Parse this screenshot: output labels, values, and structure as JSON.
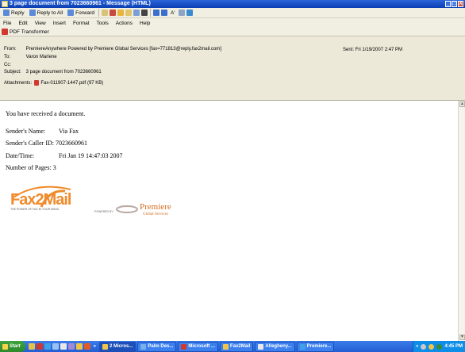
{
  "window": {
    "title": "3 page document from 7023660961 - Message (HTML)",
    "btn_minimize": "_",
    "btn_maximize": "□",
    "btn_close": "X"
  },
  "toolbar": {
    "reply": "Reply",
    "reply_all": "Reply to All",
    "forward": "Forward",
    "font": "A'"
  },
  "menu": [
    "File",
    "Edit",
    "View",
    "Insert",
    "Format",
    "Tools",
    "Actions",
    "Help"
  ],
  "toolbar2": {
    "pdf_transformer": "PDF Transformer"
  },
  "header": {
    "from_label": "From:",
    "from_value": "PremiereAnywhere Powered by Premiere Global Services [fax=771813@reply.fax2mail.com]",
    "to_label": "To:",
    "to_value": "Varon Marlene",
    "cc_label": "Cc:",
    "cc_value": "",
    "subject_label": "Subject:",
    "subject_value": "3 page document from 7023660961",
    "attachments_label": "Attachments:",
    "attachment": "Fax-011907-1447.pdf (97 KB)",
    "sent_label": "Sent:",
    "sent_value": "Fri 1/19/2007 2:47 PM"
  },
  "message": {
    "intro": "You have received a document.",
    "sender_name_label": "Sender's Name:",
    "sender_name": "Via Fax",
    "caller_id_label": "Sender's Caller ID:",
    "caller_id": "7023660961",
    "datetime_label": "Date/Time:",
    "datetime": "Fri Jan 19 14:47:03 2007",
    "pages_label": "Number of Pages:",
    "pages": "3"
  },
  "logo": {
    "fax2mail": "Fax2Mail",
    "tagline": "THE POWER OF FAX IN YOUR EMAIL",
    "powered_by": "POWERED BY",
    "premiere": "Premiere",
    "premiere_sub": "Global Services"
  },
  "taskbar": {
    "start": "Start",
    "overflow": "»",
    "tasks": [
      "2 Micros...",
      "Palm Des...",
      "Microsoft ...",
      "Fax2Mail",
      "Allegheny...",
      "Premiere..."
    ],
    "tray_chevron": "«",
    "clock": "4:45 PM"
  }
}
